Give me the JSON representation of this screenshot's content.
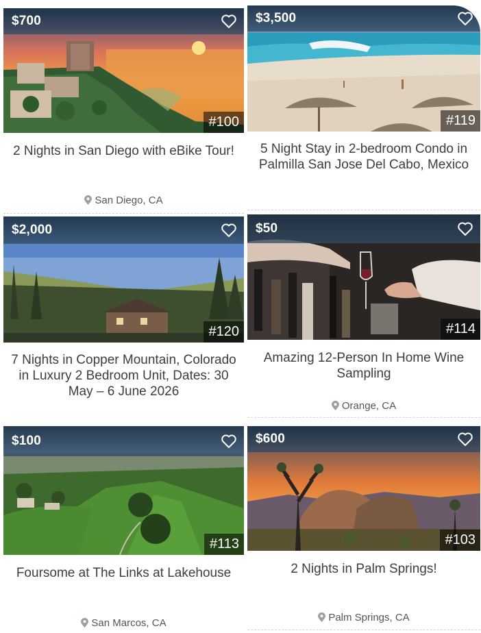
{
  "listings": [
    {
      "price": "$700",
      "id": "#100",
      "title": "2 Nights in San Diego with eBike Tour!",
      "location": "San Diego, CA"
    },
    {
      "price": "$3,500",
      "id": "#119",
      "title": "5 Night Stay in 2-bedroom Condo in Palmilla San Jose Del Cabo, Mexico",
      "location": ""
    },
    {
      "price": "$2,000",
      "id": "#120",
      "title": "7 Nights in Copper Mountain, Colorado in Luxury 2 Bedroom Unit, Dates: 30 May – 6 June 2026",
      "location": ""
    },
    {
      "price": "$50",
      "id": "#114",
      "title": "Amazing 12-Person In Home Wine Sampling",
      "location": "Orange, CA"
    },
    {
      "price": "$100",
      "id": "#113",
      "title": "Foursome at The Links at Lakehouse",
      "location": "San Marcos, CA"
    },
    {
      "price": "$600",
      "id": "#103",
      "title": "2 Nights in Palm Springs!",
      "location": "Palm Springs, CA"
    }
  ],
  "icons": {
    "favorite": "heart-outline-icon",
    "location": "map-pin-icon"
  },
  "colors": {
    "price_bar": "#2f4a63",
    "title_text": "#3d3d3d",
    "divider": "#cfd4da"
  }
}
